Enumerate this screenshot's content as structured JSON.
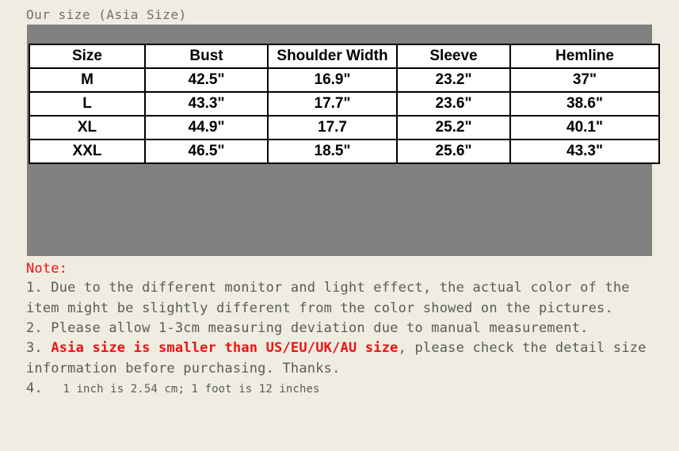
{
  "title": "Our size (Asia Size)",
  "colors": {
    "page_background": "#efede1",
    "panel": "#808080",
    "table_background": "#ffffff",
    "table_border": "#000000",
    "note_text": "#5a5a5a",
    "accent_red": "#ee1111",
    "title_text": "#6f6f6f"
  },
  "table": {
    "headers": [
      "Size",
      "Bust",
      "Shoulder Width",
      "Sleeve",
      "Hemline"
    ],
    "rows": [
      {
        "size": "M",
        "bust": "42.5\"",
        "shoulder": "16.9\"",
        "sleeve": "23.2\"",
        "hemline": "37\""
      },
      {
        "size": "L",
        "bust": "43.3\"",
        "shoulder": "17.7\"",
        "sleeve": "23.6\"",
        "hemline": "38.6\""
      },
      {
        "size": "XL",
        "bust": "44.9\"",
        "shoulder": "17.7",
        "sleeve": "25.2\"",
        "hemline": "40.1\""
      },
      {
        "size": "XXL",
        "bust": "46.5\"",
        "shoulder": "18.5\"",
        "sleeve": "25.6\"",
        "hemline": "43.3\""
      }
    ]
  },
  "notes": {
    "heading": "Note:",
    "item1": "1. Due to the different monitor and light effect, the actual color of the item might be slightly different from the color showed on the pictures.",
    "item2": "2. Please allow 1-3cm measuring deviation due to manual measurement.",
    "item3_prefix": "3. ",
    "item3_emphasis": "Asia size is smaller than US/EU/UK/AU size",
    "item3_suffix": ", please check the detail size information before purchasing. Thanks.",
    "item4_number": "4.",
    "item4_text": "1 inch is 2.54 cm; 1 foot  is 12 inches"
  }
}
